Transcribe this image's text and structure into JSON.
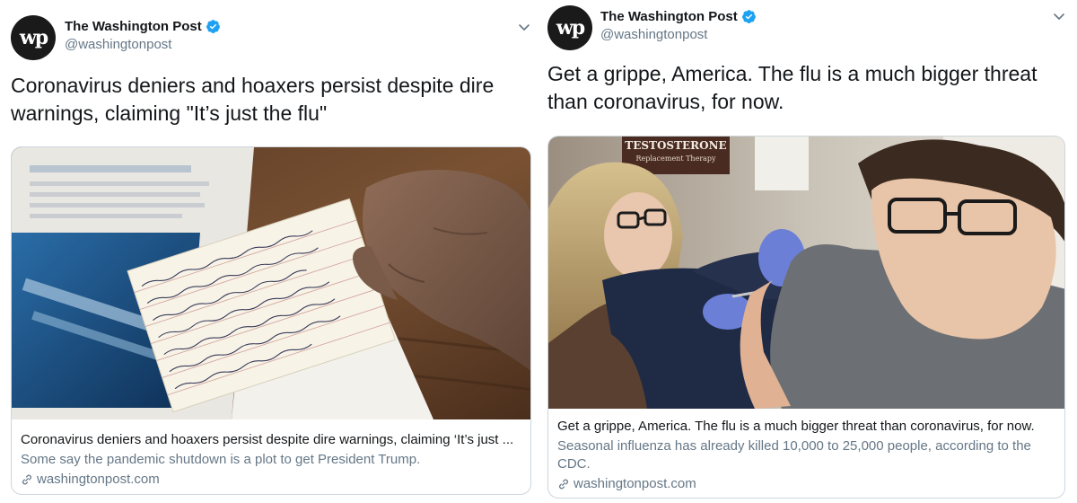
{
  "colors": {
    "verified": "#1da1f2",
    "text": "#14171a",
    "muted": "#657786",
    "border": "#ccd6dd"
  },
  "tweets": [
    {
      "avatar_text": "wp",
      "author": "The Washington Post",
      "handle": "@washingtonpost",
      "text": "Coronavirus deniers and hoaxers persist despite dire warnings, claiming \"It’s just the flu\"",
      "card": {
        "image": "hand-holding-handwritten-bible-verse-card",
        "title": "Coronavirus deniers and hoaxers persist despite dire warnings, claiming ‘It’s just ...",
        "description": "Some say the pandemic shutdown is a plot to get President Trump.",
        "domain": "washingtonpost.com"
      }
    },
    {
      "avatar_text": "wp",
      "author": "The Washington Post",
      "handle": "@washingtonpost",
      "text": "Get a grippe, America. The flu is a much bigger threat than coronavirus, for now.",
      "card": {
        "image": "nurse-giving-flu-shot-to-boy",
        "sign_text": "TESTOSTERONE",
        "sign_subtext": "Replacement Therapy",
        "title": "Get a grippe, America. The flu is a much bigger threat than coronavirus, for now.",
        "description": "Seasonal influenza has already killed 10,000 to 25,000 people, according to the CDC.",
        "domain": "washingtonpost.com"
      }
    }
  ]
}
